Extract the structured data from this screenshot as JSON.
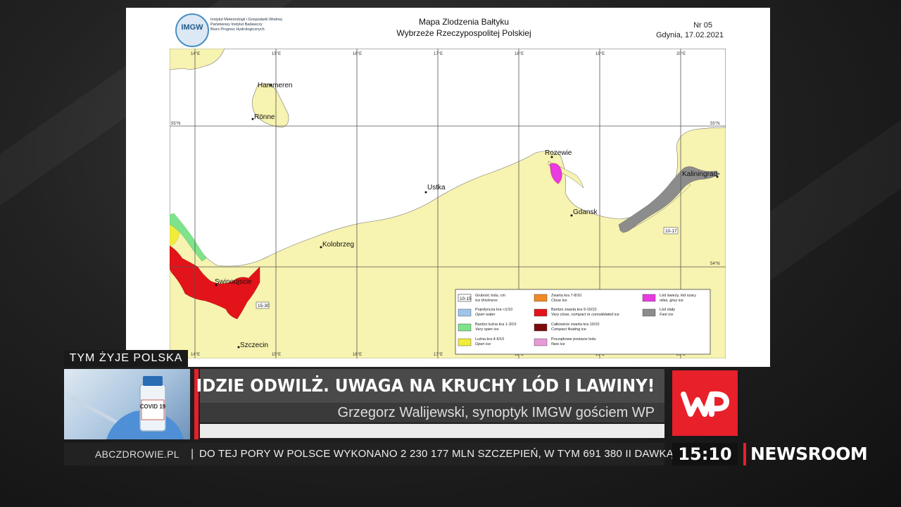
{
  "map": {
    "institute": [
      "Instytut Meteorologii i Gospodarki Wodnej",
      "Państwowy Instytut Badawczy",
      "Biuro Prognoz Hydrologicznych"
    ],
    "logo_text": "IMGW",
    "title_line1": "Mapa Zlodzenia Bałtyku",
    "title_line2": "Wybrzeże Rzeczypospolitej Polskiej",
    "number": "Nr 05",
    "date_place": "Gdynia, 17.02.2021",
    "longitudes": [
      "14°E",
      "15°E",
      "16°E",
      "17°E",
      "18°E",
      "19°E",
      "20°E"
    ],
    "latitudes": [
      "55°N",
      "54°N"
    ],
    "cities": {
      "hammeren": "Hammeren",
      "ronne": "Rönne",
      "rozewie": "Rozewie",
      "ustka": "Ustka",
      "gdansk": "Gdansk",
      "kaliningrad": "Kaliningrad",
      "kolobrzeg": "Kolobrzeg",
      "swinoujscie": "Swinoujscie",
      "szczecin": "Szczecin"
    },
    "thickness_labels": {
      "west": "15-30",
      "east": "10-17"
    },
    "legend": {
      "thickness_box": "10-15",
      "items": [
        {
          "pl": "Grubość lodu, cm",
          "en": "Ice thickness",
          "color": "none"
        },
        {
          "pl": "Pojedyncza kra <1/10",
          "en": "Open water",
          "color": "#9fc6ea"
        },
        {
          "pl": "Bardzo luźna kra 1-3/10",
          "en": "Very open ice",
          "color": "#7ee38a"
        },
        {
          "pl": "Luźna kra 4-6/10",
          "en": "Open ice",
          "color": "#f1ec3a"
        },
        {
          "pl": "Zwarta kra 7-8/10",
          "en": "Close ice",
          "color": "#f08a24"
        },
        {
          "pl": "Bardzo zwarta kra 9-10/10",
          "en": "Very close, compact or consolidated ice",
          "color": "#e3131a"
        },
        {
          "pl": "Całkowicie zwarta kra 10/10",
          "en": "Compact floating ice",
          "color": "#7a0c0c"
        },
        {
          "pl": "Początkowe postacie lodu",
          "en": "New ice",
          "color": "#e79ad8"
        },
        {
          "pl": "Lód świeży, lód szary",
          "en": "nilas, grey ice",
          "color": "#e83be0"
        },
        {
          "pl": "Lód stały",
          "en": "Fast ice",
          "color": "#8c8c8c"
        }
      ]
    }
  },
  "lower_third": {
    "tag": "TYM ŻYJE POLSKA",
    "headline": "IDZIE ODWILŻ. UWAGA NA KRUCHY LÓD I LAWINY!",
    "subline": "Grzegorz Walijewski, synoptyk IMGW gościem WP",
    "thumb_text": "COVID 19",
    "logo": "WP"
  },
  "ticker": {
    "source": "ABCZDROWIE.PL",
    "separator": "|",
    "text": "DO TEJ PORY W POLSCE WYKONANO 2 230 177 MLN SZCZEPIEŃ, W TYM 691 380 II DAWKĄ"
  },
  "clock": "15:10",
  "channel": "NEWSROOM",
  "colors": {
    "accent_red": "#e8202a",
    "land": "#f7f3b0",
    "sea": "#ffffff"
  }
}
